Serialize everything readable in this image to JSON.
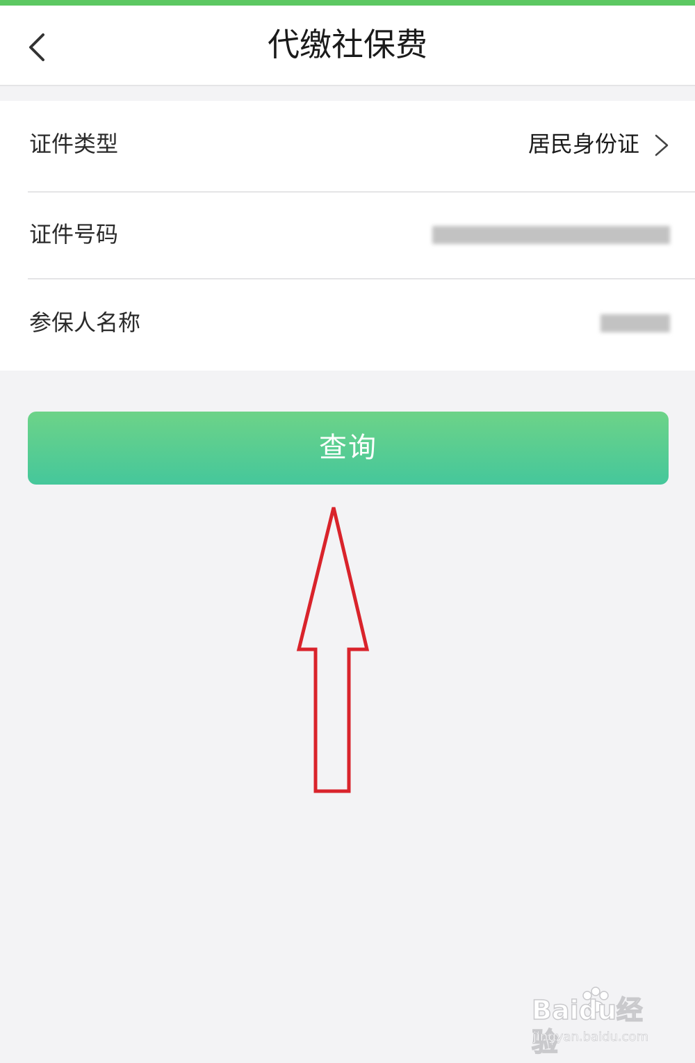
{
  "header": {
    "title": "代缴社保费",
    "back_icon": "chevron-left-icon"
  },
  "form": {
    "rows": [
      {
        "label": "证件类型",
        "value": "居民身份证",
        "icon": "chevron-right-icon"
      },
      {
        "label": "证件号码",
        "value": "[blurred]"
      },
      {
        "label": "参保人名称",
        "value": "[blurred]"
      }
    ]
  },
  "actions": {
    "query_label": "查询"
  },
  "annotation": {
    "arrow_color": "#d9232b"
  },
  "watermark": {
    "brand": "Baidu经验",
    "url": "jingyan.baidu.com"
  },
  "colors": {
    "accent_green": "#5cc862",
    "button_gradient_top": "#6dd388",
    "button_gradient_bottom": "#45c79b",
    "background": "#f3f3f5"
  }
}
